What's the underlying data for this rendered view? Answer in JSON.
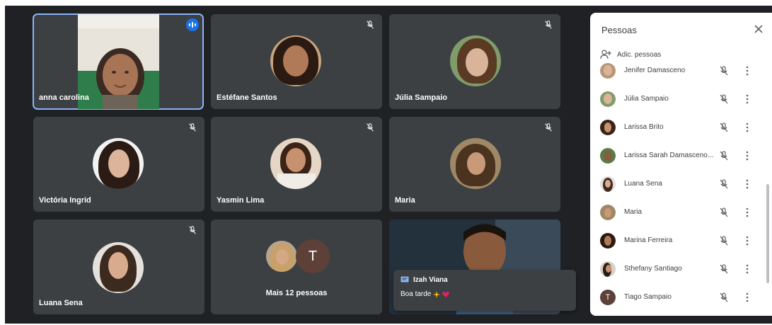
{
  "tiles": [
    {
      "name": "anna carolina",
      "muted": false,
      "speaking": true
    },
    {
      "name": "Estéfane Santos",
      "muted": true
    },
    {
      "name": "Júlia Sampaio",
      "muted": true
    },
    {
      "name": "Victória Ingrid",
      "muted": true
    },
    {
      "name": "Yasmin Lima",
      "muted": true
    },
    {
      "name": "Maria",
      "muted": true
    },
    {
      "name": "Luana Sena",
      "muted": true
    },
    {
      "name": "",
      "muted": false
    }
  ],
  "more_tile": {
    "label": "Mais 12 pessoas",
    "avatar_letter": "T"
  },
  "chat": {
    "sender": "Izah Viana",
    "message": "Boa tarde"
  },
  "panel": {
    "title": "Pessoas",
    "add_label": "Adic. pessoas",
    "people": [
      {
        "name": "Jenifer Damasceno",
        "avatar": "photo"
      },
      {
        "name": "Júlia Sampaio",
        "avatar": "photo"
      },
      {
        "name": "Larissa Brito",
        "avatar": "photo"
      },
      {
        "name": "Larissa Sarah Damasceno...",
        "avatar": "photo"
      },
      {
        "name": "Luana Sena",
        "avatar": "photo"
      },
      {
        "name": "Maria",
        "avatar": "photo"
      },
      {
        "name": "Marina Ferreira",
        "avatar": "photo"
      },
      {
        "name": "Sthefany Santiago",
        "avatar": "photo"
      },
      {
        "name": "Tiago Sampaio",
        "avatar": "letter",
        "letter": "T"
      }
    ]
  },
  "colors": {
    "stage_bg": "#202124",
    "tile_bg": "#3c4043",
    "active_outline": "#8ab4f8",
    "speaking_badge": "#1a73e8",
    "tiago_avatar": "#5d4037"
  },
  "icons": {
    "mic": "mic-off-icon",
    "speaking": "audio-level-icon",
    "close": "close-icon",
    "add_person": "person-add-icon",
    "more": "more-vert-icon",
    "chat": "chat-icon"
  }
}
